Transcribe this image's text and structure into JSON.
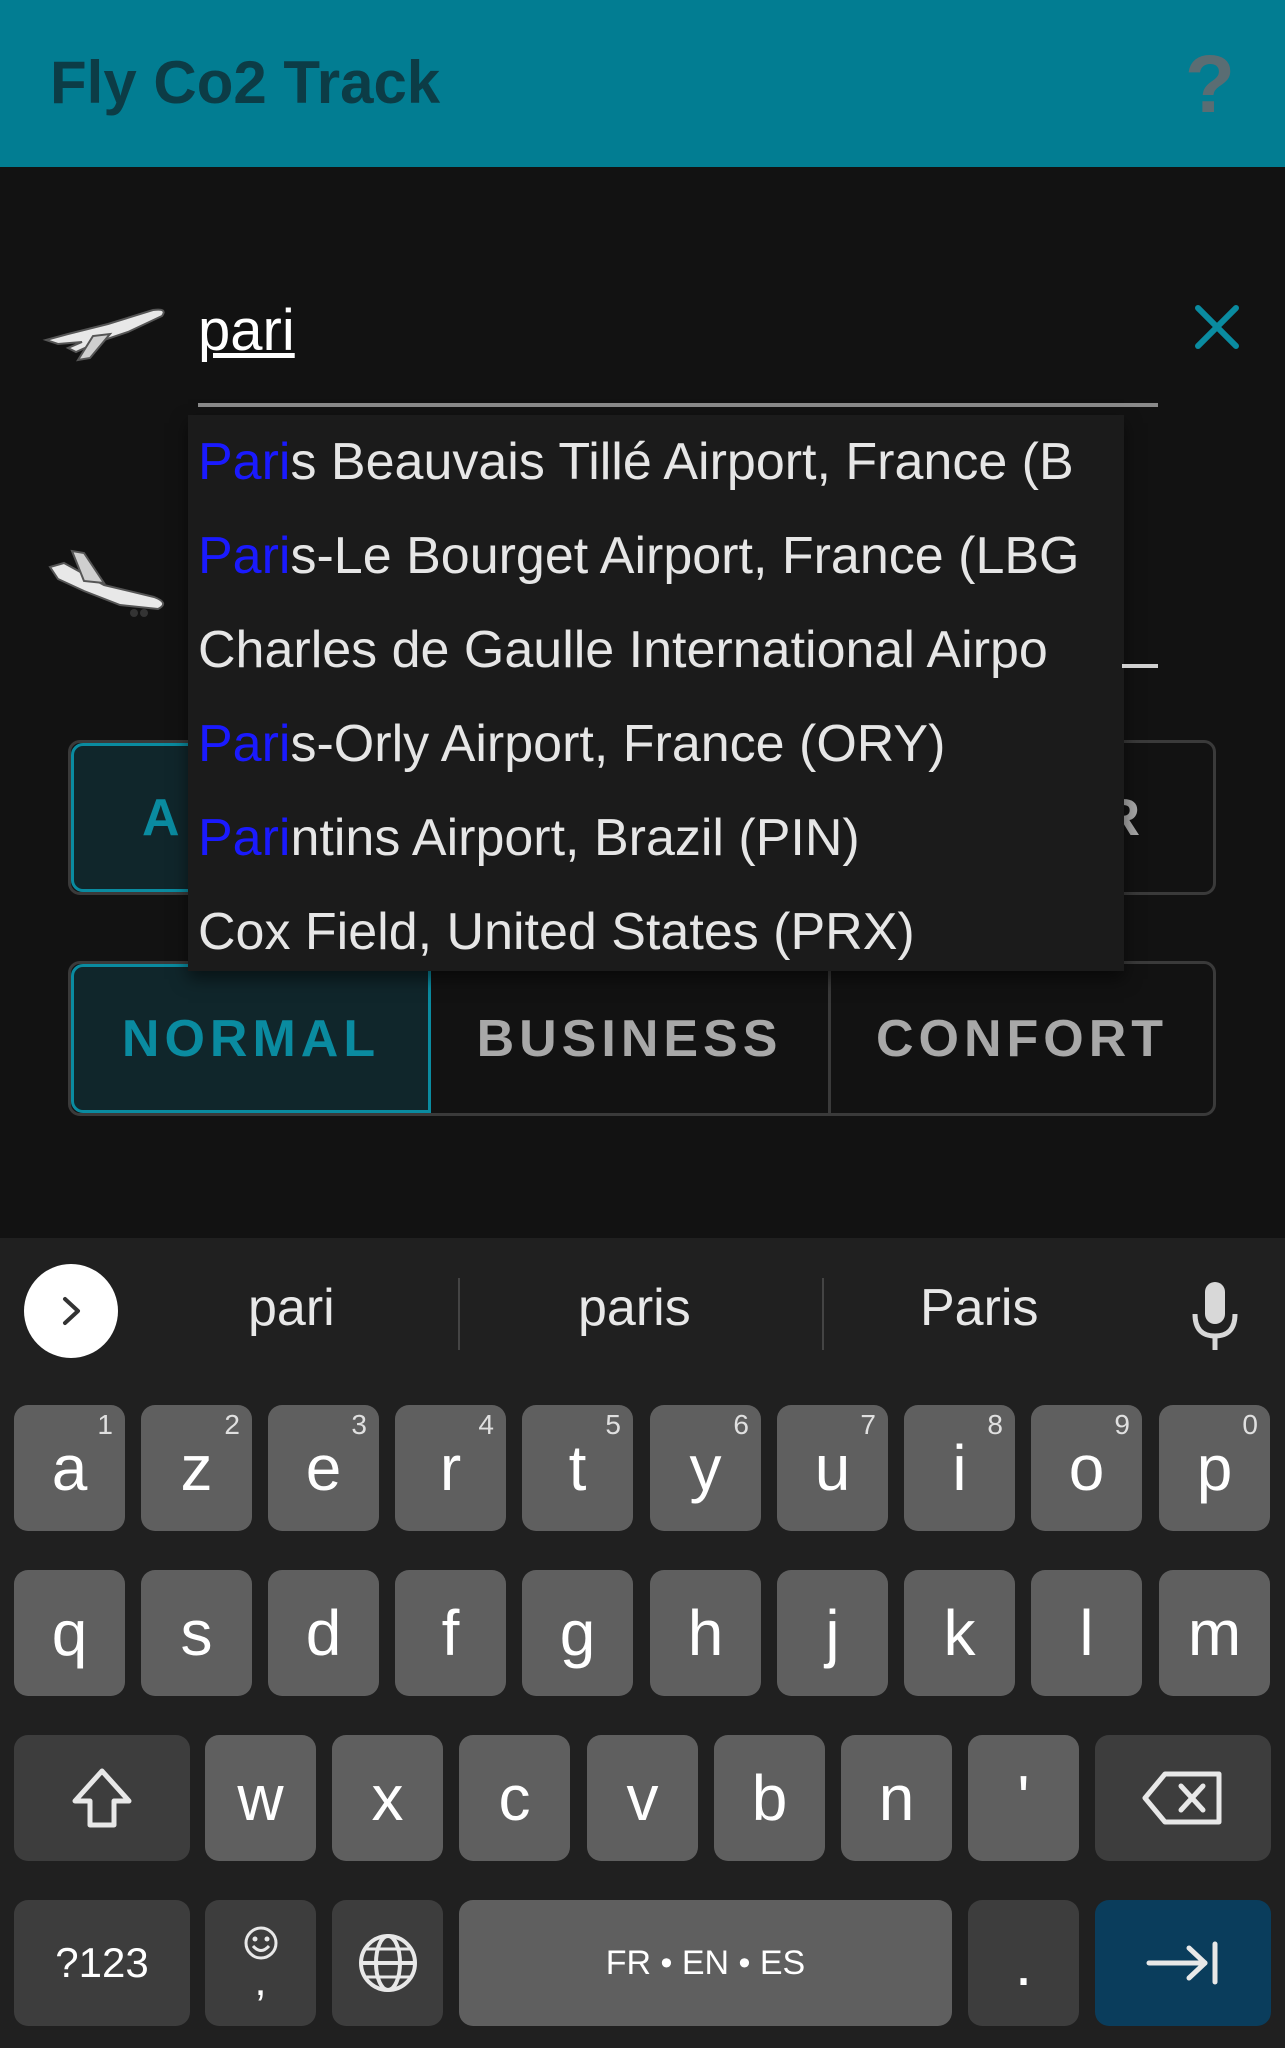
{
  "app": {
    "title": "Fly Co2 Track",
    "help_symbol": "?"
  },
  "search": {
    "value": "pari"
  },
  "toggles_row1": [
    "A",
    "R"
  ],
  "class_toggles": [
    "NORMAL",
    "BUSINESS",
    "CONFORT"
  ],
  "suggestions": [
    {
      "highlight": "Pari",
      "rest": "s Beauvais Tillé Airport, France (B"
    },
    {
      "highlight": "Pari",
      "rest": "s-Le Bourget Airport, France (LBG"
    },
    {
      "highlight": "",
      "rest": "Charles de Gaulle International Airpo"
    },
    {
      "highlight": "Pari",
      "rest": "s-Orly Airport, France (ORY)"
    },
    {
      "highlight": "Pari",
      "rest": "ntins Airport, Brazil (PIN)"
    },
    {
      "highlight": "",
      "rest": "Cox Field, United States (PRX)"
    }
  ],
  "keyboard": {
    "word_suggestions": [
      "pari",
      "paris",
      "Paris"
    ],
    "row1": [
      {
        "k": "a",
        "h": "1"
      },
      {
        "k": "z",
        "h": "2"
      },
      {
        "k": "e",
        "h": "3"
      },
      {
        "k": "r",
        "h": "4"
      },
      {
        "k": "t",
        "h": "5"
      },
      {
        "k": "y",
        "h": "6"
      },
      {
        "k": "u",
        "h": "7"
      },
      {
        "k": "i",
        "h": "8"
      },
      {
        "k": "o",
        "h": "9"
      },
      {
        "k": "p",
        "h": "0"
      }
    ],
    "row2": [
      "q",
      "s",
      "d",
      "f",
      "g",
      "h",
      "j",
      "k",
      "l",
      "m"
    ],
    "row3": [
      "w",
      "x",
      "c",
      "v",
      "b",
      "n",
      "'"
    ],
    "symbols_label": "?123",
    "comma": ",",
    "space_label": "FR • EN • ES",
    "period": "."
  },
  "colors": {
    "appbar": "#027d92",
    "accent": "#0a8ba0",
    "highlight": "#1a1aff"
  }
}
